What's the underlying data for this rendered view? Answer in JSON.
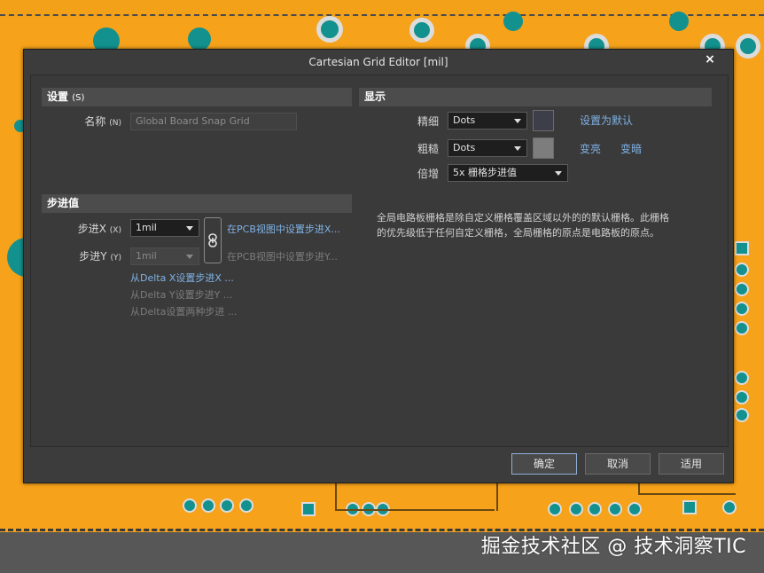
{
  "window": {
    "title": "Cartesian Grid Editor [mil]",
    "close": "×"
  },
  "settings": {
    "header": "设置",
    "header_accel": "(S)",
    "name_label": "名称",
    "name_accel": "(N)",
    "name_value": "Global Board Snap Grid"
  },
  "step": {
    "header": "步进值",
    "x_label": "步进X",
    "x_accel": "(X)",
    "x_value": "1mil",
    "y_label": "步进Y",
    "y_accel": "(Y)",
    "y_value": "1mil",
    "set_x_in_pcb": "在PCB视图中设置步进X...",
    "set_y_in_pcb": "在PCB视图中设置步进Y...",
    "from_delta_x": "从Delta X设置步进X ...",
    "from_delta_y": "从Delta Y设置步进Y ...",
    "from_delta_both": "从Delta设置两种步进 ..."
  },
  "display": {
    "header": "显示",
    "fine_label": "精细",
    "fine_value": "Dots",
    "fine_color": "#3e3e4a",
    "coarse_label": "粗糙",
    "coarse_value": "Dots",
    "coarse_color": "#7d7d7d",
    "multiplier_label": "倍增",
    "multiplier_value": "5x 栅格步进值",
    "set_default": "设置为默认",
    "lighter": "变亮",
    "darker": "变暗",
    "description_line1": "全局电路板栅格是除自定义栅格覆盖区域以外的的默认栅格。此栅格",
    "description_line2": "的优先级低于任何自定义栅格，全局栅格的原点是电路板的原点。"
  },
  "buttons": {
    "ok": "确定",
    "cancel": "取消",
    "apply": "适用"
  },
  "watermark": "掘金技术社区 @ 技术洞察TIC",
  "colors": {
    "pcb": "#f6a21a",
    "pad": "#13918e",
    "dialog": "#3c3c3c",
    "link": "#7fb2e6"
  }
}
